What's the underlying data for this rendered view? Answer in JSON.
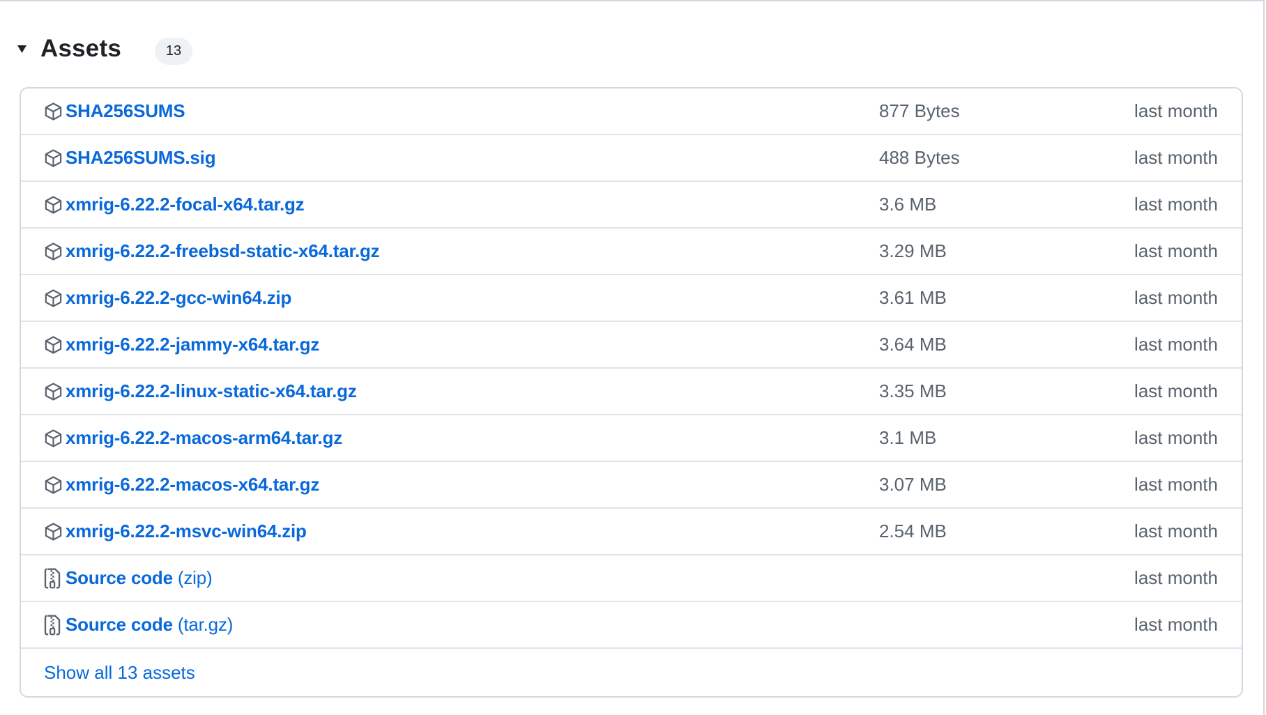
{
  "header": {
    "toggle_icon": "triangle-down-icon",
    "title": "Assets",
    "count": "13"
  },
  "colors": {
    "link": "#0969da",
    "muted_text": "#59636e",
    "border": "#d1d9e0",
    "badge_bg": "#eff2f5"
  },
  "assets": [
    {
      "name": "SHA256SUMS",
      "suffix": "",
      "icon": "package-icon",
      "size": "877 Bytes",
      "date": "last month"
    },
    {
      "name": "SHA256SUMS.sig",
      "suffix": "",
      "icon": "package-icon",
      "size": "488 Bytes",
      "date": "last month"
    },
    {
      "name": "xmrig-6.22.2-focal-x64.tar.gz",
      "suffix": "",
      "icon": "package-icon",
      "size": "3.6 MB",
      "date": "last month"
    },
    {
      "name": "xmrig-6.22.2-freebsd-static-x64.tar.gz",
      "suffix": "",
      "icon": "package-icon",
      "size": "3.29 MB",
      "date": "last month"
    },
    {
      "name": "xmrig-6.22.2-gcc-win64.zip",
      "suffix": "",
      "icon": "package-icon",
      "size": "3.61 MB",
      "date": "last month"
    },
    {
      "name": "xmrig-6.22.2-jammy-x64.tar.gz",
      "suffix": "",
      "icon": "package-icon",
      "size": "3.64 MB",
      "date": "last month"
    },
    {
      "name": "xmrig-6.22.2-linux-static-x64.tar.gz",
      "suffix": "",
      "icon": "package-icon",
      "size": "3.35 MB",
      "date": "last month"
    },
    {
      "name": "xmrig-6.22.2-macos-arm64.tar.gz",
      "suffix": "",
      "icon": "package-icon",
      "size": "3.1 MB",
      "date": "last month"
    },
    {
      "name": "xmrig-6.22.2-macos-x64.tar.gz",
      "suffix": "",
      "icon": "package-icon",
      "size": "3.07 MB",
      "date": "last month"
    },
    {
      "name": "xmrig-6.22.2-msvc-win64.zip",
      "suffix": "",
      "icon": "package-icon",
      "size": "2.54 MB",
      "date": "last month"
    },
    {
      "name": "Source code",
      "suffix": " (zip)",
      "icon": "file-zip-icon",
      "size": "",
      "date": "last month"
    },
    {
      "name": "Source code",
      "suffix": " (tar.gz)",
      "icon": "file-zip-icon",
      "size": "",
      "date": "last month"
    }
  ],
  "footer": {
    "show_all_label": "Show all 13 assets"
  }
}
